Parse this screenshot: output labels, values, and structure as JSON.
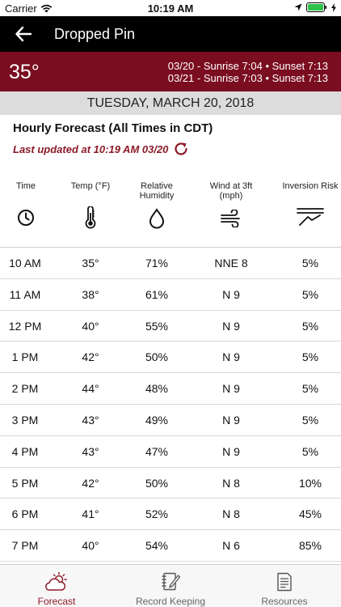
{
  "status": {
    "carrier": "Carrier",
    "time": "10:19 AM"
  },
  "nav": {
    "title": "Dropped Pin"
  },
  "current": {
    "temp": "35°",
    "sun_line1": "03/20 - Sunrise 7:04 • Sunset 7:13",
    "sun_line2": "03/21 - Sunrise 7:03 • Sunset 7:13"
  },
  "date": "TUESDAY, MARCH 20, 2018",
  "hourly": {
    "title": "Hourly Forecast (All Times in CDT)",
    "updated": "Last updated at 10:19 AM 03/20"
  },
  "columns": [
    {
      "label": "Time",
      "icon": "clock-icon"
    },
    {
      "label": "Temp (°F)",
      "icon": "thermometer-icon"
    },
    {
      "label": "Relative Humidity",
      "icon": "droplet-icon"
    },
    {
      "label": "Wind at 3ft (mph)",
      "icon": "wind-icon"
    },
    {
      "label": "Inversion Risk",
      "icon": "inversion-icon"
    }
  ],
  "rows": [
    {
      "time": "10 AM",
      "temp": "35°",
      "rh": "71%",
      "wind": "NNE 8",
      "risk": "5%"
    },
    {
      "time": "11 AM",
      "temp": "38°",
      "rh": "61%",
      "wind": "N 9",
      "risk": "5%"
    },
    {
      "time": "12 PM",
      "temp": "40°",
      "rh": "55%",
      "wind": "N 9",
      "risk": "5%"
    },
    {
      "time": "1 PM",
      "temp": "42°",
      "rh": "50%",
      "wind": "N 9",
      "risk": "5%"
    },
    {
      "time": "2 PM",
      "temp": "44°",
      "rh": "48%",
      "wind": "N 9",
      "risk": "5%"
    },
    {
      "time": "3 PM",
      "temp": "43°",
      "rh": "49%",
      "wind": "N 9",
      "risk": "5%"
    },
    {
      "time": "4 PM",
      "temp": "43°",
      "rh": "47%",
      "wind": "N 9",
      "risk": "5%"
    },
    {
      "time": "5 PM",
      "temp": "42°",
      "rh": "50%",
      "wind": "N 8",
      "risk": "10%"
    },
    {
      "time": "6 PM",
      "temp": "41°",
      "rh": "52%",
      "wind": "N 8",
      "risk": "45%"
    },
    {
      "time": "7 PM",
      "temp": "40°",
      "rh": "54%",
      "wind": "N 6",
      "risk": "85%"
    }
  ],
  "tabs": [
    {
      "label": "Forecast",
      "icon": "cloud-sun-icon",
      "active": true
    },
    {
      "label": "Record Keeping",
      "icon": "notebook-pen-icon",
      "active": false
    },
    {
      "label": "Resources",
      "icon": "document-icon",
      "active": false
    }
  ],
  "colors": {
    "accent": "#7a0d20",
    "accent_text": "#8b1a28",
    "nav_bg": "#000000",
    "date_band": "#dcdcdc"
  }
}
